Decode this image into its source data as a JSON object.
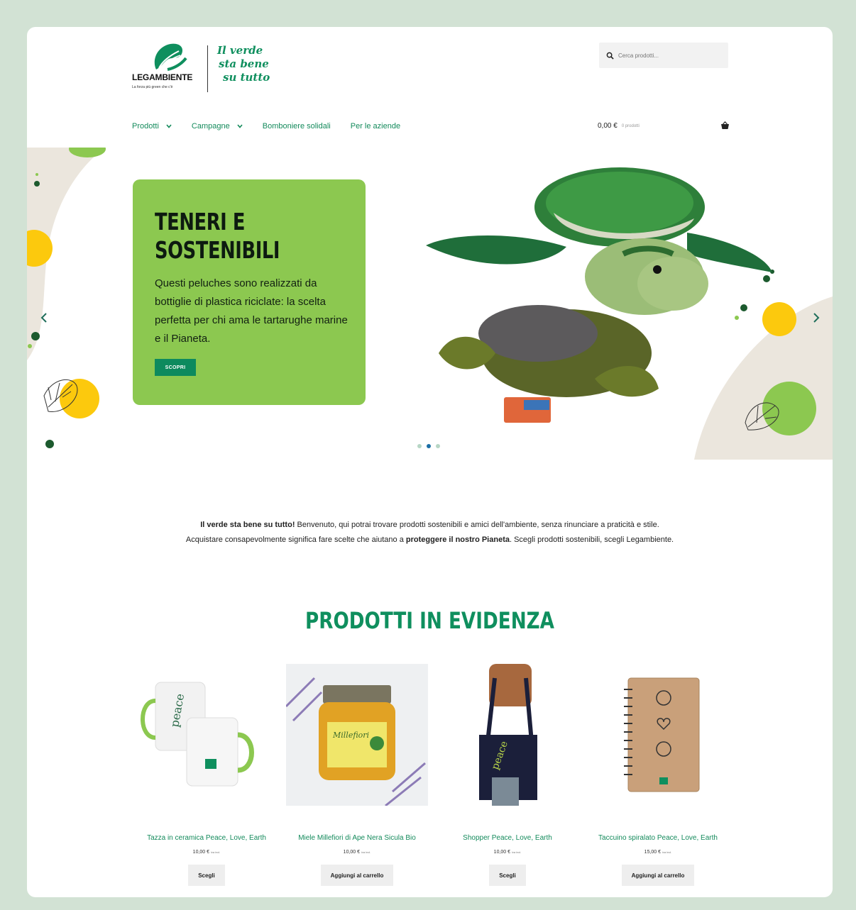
{
  "brand": {
    "name": "LEGAMBIENTE",
    "tagline": "La forza più green che c'è",
    "slogan_lines": [
      "Il verde",
      "sta bene",
      "su tutto"
    ]
  },
  "search": {
    "placeholder": "Cerca prodotti..."
  },
  "nav": {
    "items": [
      {
        "label": "Prodotti",
        "has_dropdown": true
      },
      {
        "label": "Campagne",
        "has_dropdown": true
      },
      {
        "label": "Bomboniere solidali",
        "has_dropdown": false
      },
      {
        "label": "Per le aziende",
        "has_dropdown": false
      }
    ]
  },
  "cart": {
    "total": "0,00 €",
    "count": "0 prodotti"
  },
  "hero": {
    "title_line1": "TENERI E",
    "title_line2": "SOSTENIBILI",
    "text": "Questi peluches sono realizzati da bottiglie di plastica riciclate: la scelta perfetta per chi ama le tartarughe marine e il Pianeta.",
    "button": "SCOPRI",
    "slides": 3,
    "active_slide": 2
  },
  "intro": {
    "line1_bold": "Il verde sta bene su tutto!",
    "line1_rest": " Benvenuto, qui potrai trovare prodotti sostenibili e amici dell'ambiente, senza rinunciare a praticità e stile.",
    "line2_start": "Acquistare consapevolmente significa fare scelte che aiutano a ",
    "line2_bold": "proteggere il nostro Pianeta",
    "line2_end": ". Scegli prodotti sostenibili, scegli Legambiente."
  },
  "featured": {
    "title": "PRODOTTI IN EVIDENZA",
    "products": [
      {
        "name": "Tazza in ceramica Peace, Love, Earth",
        "price": "10,00 €",
        "tax": "iva incl.",
        "button": "Scegli"
      },
      {
        "name": "Miele Millefiori di Ape Nera Sicula Bio",
        "price": "10,00 €",
        "tax": "iva incl.",
        "button": "Aggiungi al carrello"
      },
      {
        "name": "Shopper Peace, Love, Earth",
        "price": "10,00 €",
        "tax": "iva incl.",
        "button": "Scegli"
      },
      {
        "name": "Taccuino spiralato Peace, Love, Earth",
        "price": "15,00 €",
        "tax": "iva incl.",
        "button": "Aggiungi al carrello"
      }
    ]
  },
  "colors": {
    "brand_green": "#0f8f5e",
    "hero_green": "#8cc850",
    "accent_yellow": "#fcc90d",
    "frame": "#d2e2d4"
  }
}
